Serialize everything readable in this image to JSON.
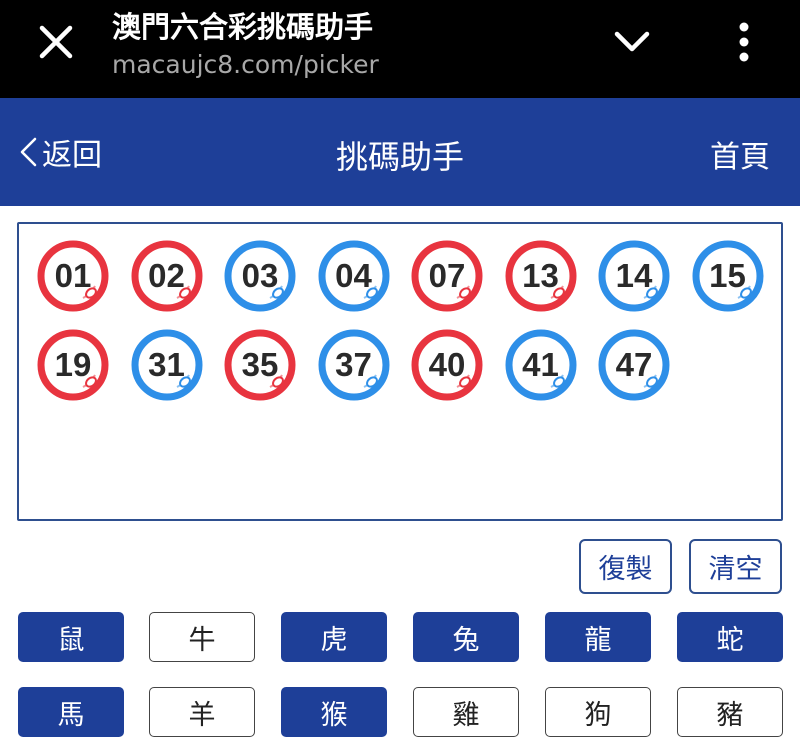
{
  "browser": {
    "title": "澳門六合彩挑碼助手",
    "url": "macaujc8.com/picker",
    "icons": {
      "close": "close-icon",
      "collapse": "chevron-down-icon",
      "menu": "more-vert-icon"
    }
  },
  "header": {
    "back_label": "返回",
    "title": "挑碼助手",
    "home_label": "首頁",
    "background": "#1e3f98"
  },
  "colors": {
    "red": "#e8343f",
    "blue": "#2e8fe8",
    "accent": "#1e3f98"
  },
  "balls": [
    {
      "number": "01",
      "color": "red"
    },
    {
      "number": "02",
      "color": "red"
    },
    {
      "number": "03",
      "color": "blue"
    },
    {
      "number": "04",
      "color": "blue"
    },
    {
      "number": "07",
      "color": "red"
    },
    {
      "number": "13",
      "color": "red"
    },
    {
      "number": "14",
      "color": "blue"
    },
    {
      "number": "15",
      "color": "blue"
    },
    {
      "number": "19",
      "color": "red"
    },
    {
      "number": "31",
      "color": "blue"
    },
    {
      "number": "35",
      "color": "red"
    },
    {
      "number": "37",
      "color": "blue"
    },
    {
      "number": "40",
      "color": "red"
    },
    {
      "number": "41",
      "color": "blue"
    },
    {
      "number": "47",
      "color": "blue"
    }
  ],
  "actions": {
    "copy_label": "復製",
    "clear_label": "清空"
  },
  "zodiac": [
    {
      "label": "鼠",
      "selected": true
    },
    {
      "label": "牛",
      "selected": false
    },
    {
      "label": "虎",
      "selected": true
    },
    {
      "label": "兔",
      "selected": true
    },
    {
      "label": "龍",
      "selected": true
    },
    {
      "label": "蛇",
      "selected": true
    },
    {
      "label": "馬",
      "selected": true
    },
    {
      "label": "羊",
      "selected": false
    },
    {
      "label": "猴",
      "selected": true
    },
    {
      "label": "雞",
      "selected": false
    },
    {
      "label": "狗",
      "selected": false
    },
    {
      "label": "豬",
      "selected": false
    }
  ]
}
